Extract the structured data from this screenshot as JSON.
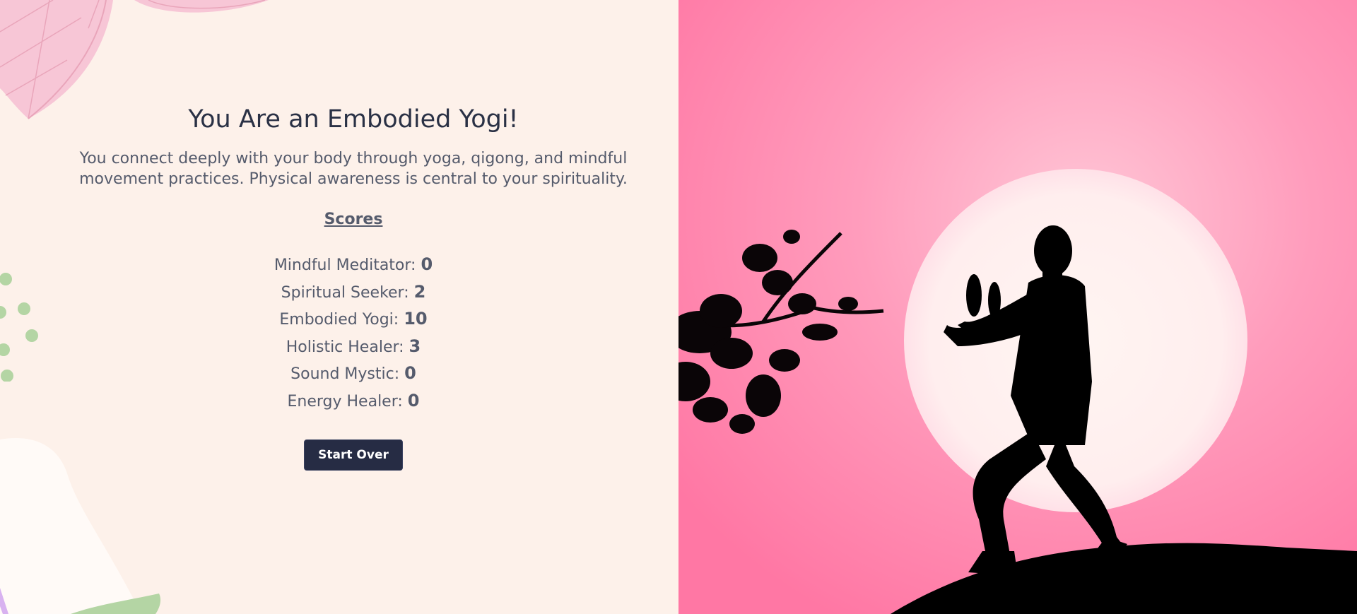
{
  "result": {
    "title": "You Are an Embodied Yogi!",
    "description": "You connect deeply with your body through yoga, qigong, and mindful movement practices. Physical awareness is central to your spirituality."
  },
  "scores": {
    "heading": "Scores",
    "items": [
      {
        "label": "Mindful Meditator:",
        "value": "0"
      },
      {
        "label": "Spiritual Seeker:",
        "value": "2"
      },
      {
        "label": "Embodied Yogi:",
        "value": "10"
      },
      {
        "label": "Holistic Healer:",
        "value": "3"
      },
      {
        "label": "Sound Mystic:",
        "value": "0"
      },
      {
        "label": "Energy Healer:",
        "value": "0"
      }
    ]
  },
  "actions": {
    "start_over_label": "Start Over"
  },
  "colors": {
    "page_background": "#fdf1ea",
    "title_text": "#2a3145",
    "body_text": "#555b6c",
    "button_background": "#262c44",
    "hero_pink": "#ff80a8",
    "moon": "#fff3f0",
    "silhouette": "#000000"
  },
  "icons": {
    "top_left_decoration": "leaf-illustration",
    "left_decoration": "green-dots",
    "hero_image": "qigong-silhouette-moon"
  }
}
